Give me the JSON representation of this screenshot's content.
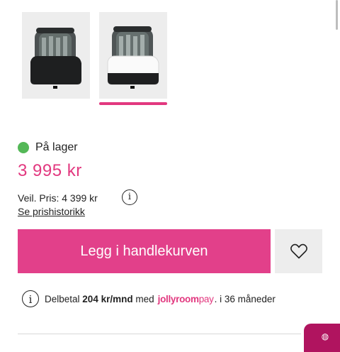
{
  "gallery": {
    "thumbnails": [
      {
        "name": "black",
        "selected": false
      },
      {
        "name": "white",
        "selected": true
      }
    ],
    "indicator_color": "#e2387f"
  },
  "stock": {
    "label": "På lager",
    "status_color": "#54b857"
  },
  "price": {
    "current": "3 995 kr",
    "color": "#e2387f"
  },
  "rrp": {
    "label": "Veil. Pris: 4 399 kr",
    "history_link": "Se prishistorikk"
  },
  "actions": {
    "add_to_cart": "Legg i handlekurven",
    "button_color": "#e2408a",
    "wishlist_icon": "heart-icon"
  },
  "installment": {
    "prefix": "Delbetal",
    "amount": "204 kr/mnd",
    "with": "med",
    "brand_bold": "jollyroom",
    "brand_light": "pay",
    "suffix": ". i 36 måneder"
  }
}
